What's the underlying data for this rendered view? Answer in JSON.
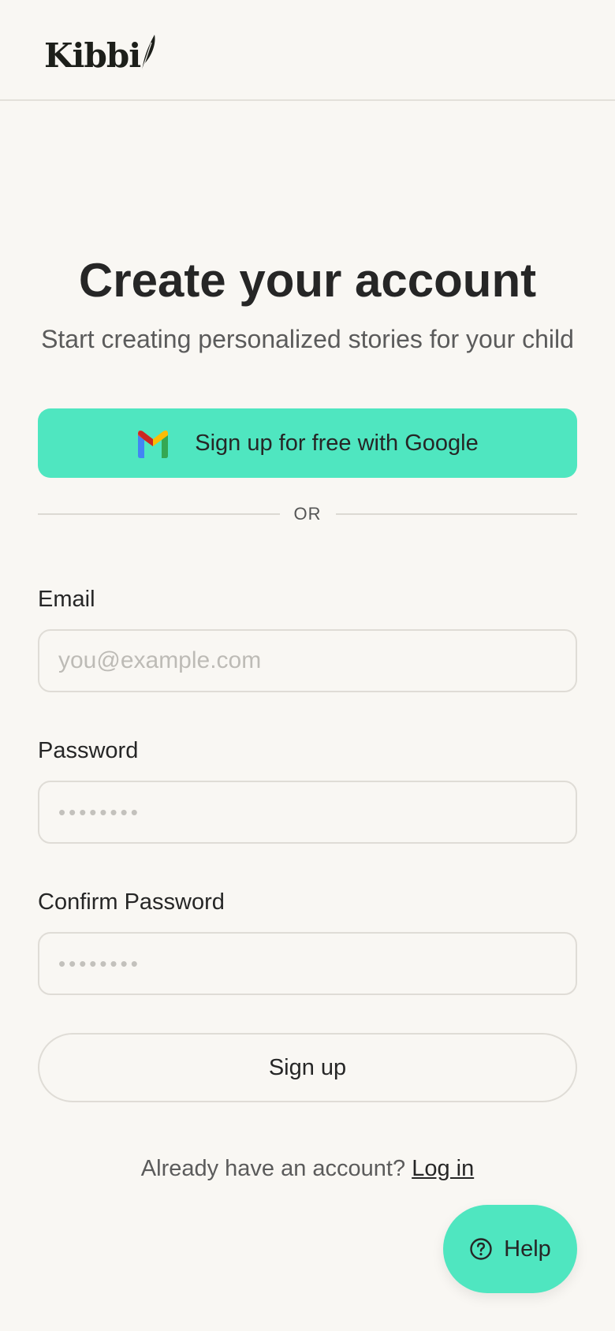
{
  "header": {
    "logo_text": "Kibbi",
    "logo_icon": "feather-icon"
  },
  "main": {
    "title": "Create your account",
    "subtitle": "Start creating personalized stories for your child",
    "google_button": {
      "label": "Sign up for free with Google",
      "icon": "gmail-icon",
      "color": "#4fe6c0"
    },
    "divider_text": "OR",
    "email": {
      "label": "Email",
      "placeholder": "you@example.com",
      "value": ""
    },
    "password": {
      "label": "Password",
      "placeholder": "••••••••",
      "value": ""
    },
    "confirm_password": {
      "label": "Confirm Password",
      "placeholder": "••••••••",
      "value": ""
    },
    "signup_button": {
      "label": "Sign up"
    },
    "login_prompt": {
      "text": "Already have an account?",
      "link_text": "Log in"
    }
  },
  "help_button": {
    "label": "Help",
    "icon": "question-circle-icon",
    "color": "#4fe6c0"
  },
  "colors": {
    "background": "#f9f7f3",
    "accent": "#4fe6c0",
    "text": "#262626",
    "muted_text": "#5b5b5b"
  }
}
